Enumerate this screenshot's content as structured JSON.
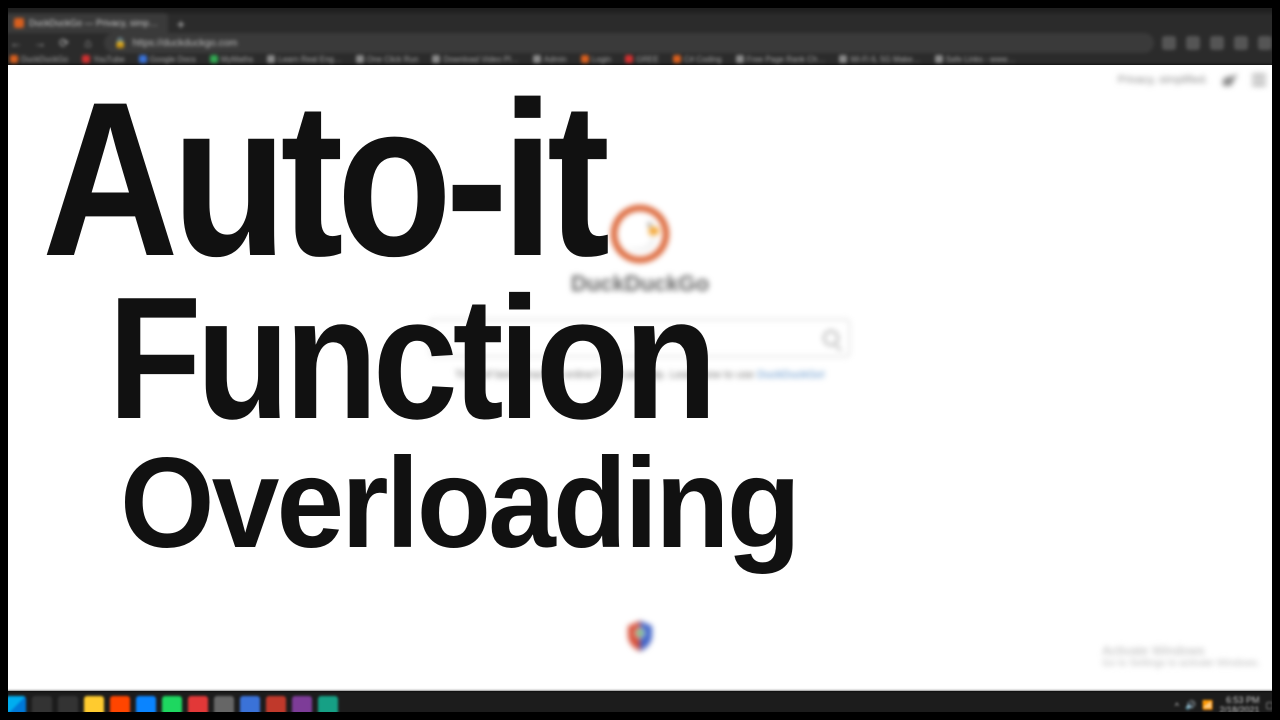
{
  "browser": {
    "tab_title": "DuckDuckGo — Privacy, simp…",
    "url": "https://duckduckgo.com",
    "newtab_glyph": "+",
    "bookmarks": [
      {
        "label": "DuckDuckGo",
        "color": "#d85f1e"
      },
      {
        "label": "YouTube",
        "color": "#d03030"
      },
      {
        "label": "Google Docs",
        "color": "#3a72d8"
      },
      {
        "label": "MyMaths",
        "color": "#32a852"
      },
      {
        "label": "Learn Real Eng…",
        "color": "#888888"
      },
      {
        "label": "One Click Run",
        "color": "#888888"
      },
      {
        "label": "Download Video Pl…",
        "color": "#888888"
      },
      {
        "label": "Admin",
        "color": "#888888"
      },
      {
        "label": "Login",
        "color": "#d85f1e"
      },
      {
        "label": "GREE",
        "color": "#d03030"
      },
      {
        "label": "C# Coding",
        "color": "#d85f1e"
      },
      {
        "label": "Free Page Rank Ch…",
        "color": "#888888"
      },
      {
        "label": "Wi-Fi 6, 5G Make…",
        "color": "#888888"
      },
      {
        "label": "Safe Links - www…",
        "color": "#888888"
      }
    ]
  },
  "page": {
    "brand": "DuckDuckGo",
    "search_placeholder": "",
    "privacy_label": "Privacy, simplified.",
    "tagline_prefix": "Tired of being tracked online? We can help. Learn how to use",
    "tagline_link": "DuckDuckGo!",
    "activate_line1": "Activate Windows",
    "activate_line2": "Go to Settings to activate Windows."
  },
  "overlay": {
    "line1": "Auto-it",
    "line2": "Function",
    "line3": "Overloading"
  },
  "tray": {
    "time": "6:53 PM",
    "date": "2/18/2021"
  }
}
